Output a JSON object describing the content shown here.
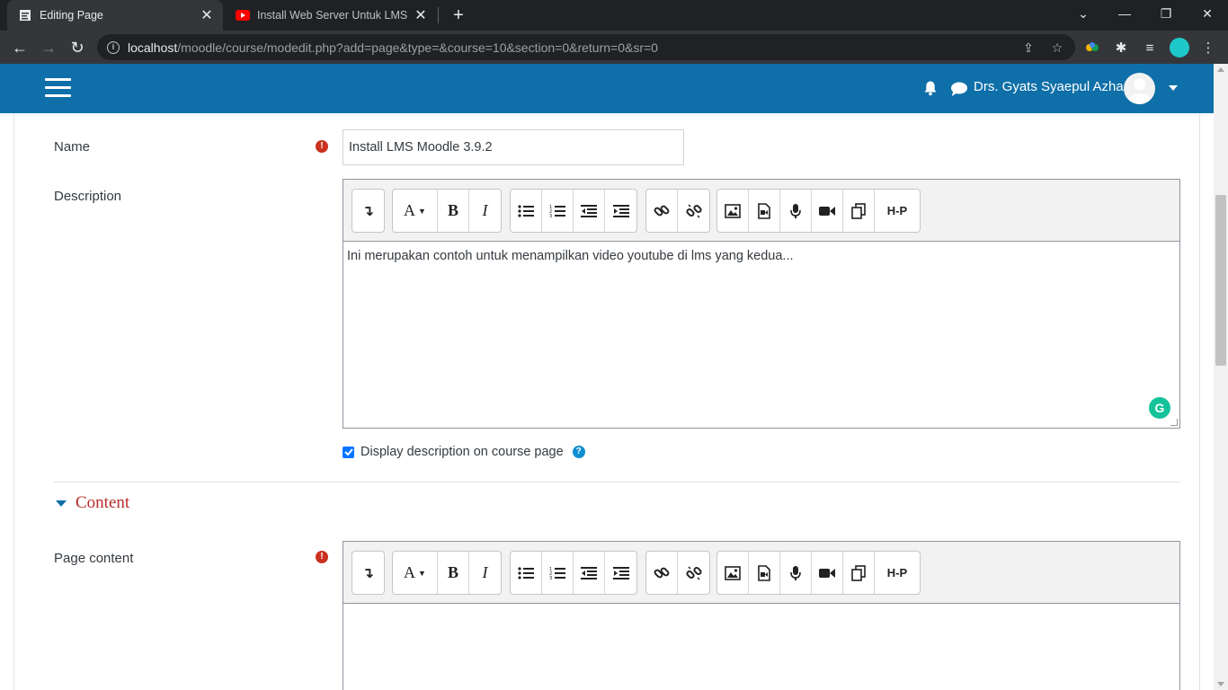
{
  "browser": {
    "tabs": [
      {
        "title": "Editing Page",
        "icon": "moodle-favicon",
        "active": true
      },
      {
        "title": "Install Web Server Untuk LMS Mo",
        "icon": "youtube-favicon",
        "active": false
      }
    ],
    "url_host": "localhost",
    "url_path": "/moodle/course/modedit.php?add=page&type=&course=10&section=0&return=0&sr=0"
  },
  "header": {
    "user_name": "Drs. Gyats Syaepul Azhar",
    "brand_color": "#0f6fa8"
  },
  "form": {
    "name_label": "Name",
    "name_value": "Install LMS Moodle 3.9.2",
    "description_label": "Description",
    "description_text": "Ini merupakan contoh untuk menampilkan video youtube di lms yang kedua...",
    "display_description_label": "Display description on course page",
    "display_description_checked": true,
    "content_section_title": "Content",
    "page_content_label": "Page content",
    "page_content_text": ""
  },
  "toolbar": {
    "font_label": "A",
    "bold_label": "B",
    "italic_label": "I",
    "h5p_label": "H-P"
  },
  "colors": {
    "required": "#ca3120",
    "section_title": "#b52d2a",
    "grammarly": "#15c39a"
  }
}
